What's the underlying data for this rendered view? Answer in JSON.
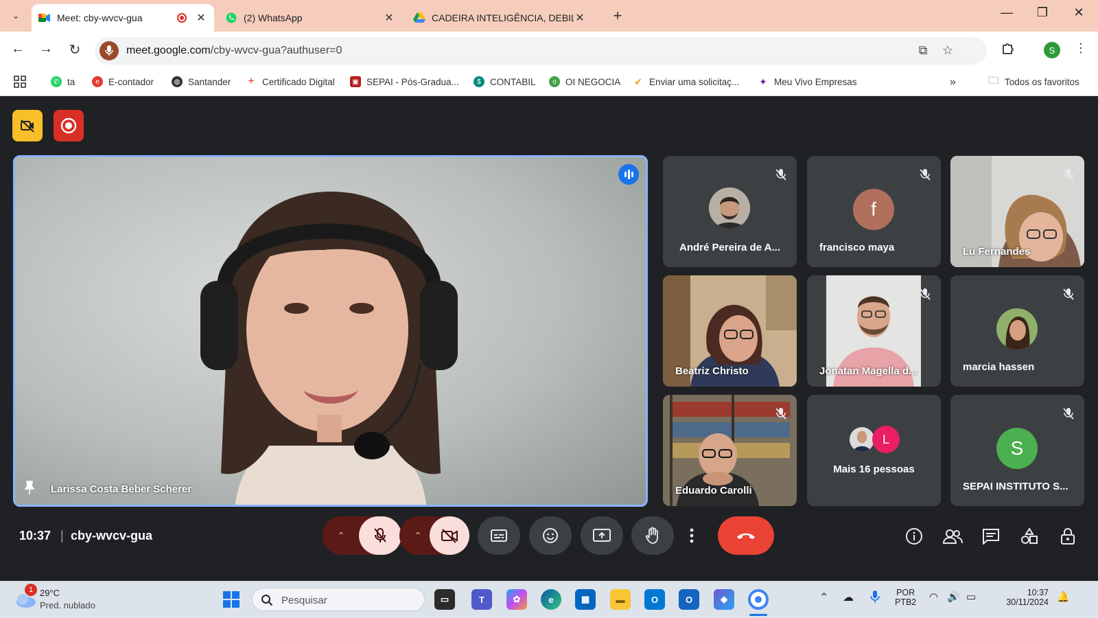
{
  "browser": {
    "tabs": [
      {
        "title": "Meet: cby-wvcv-gua",
        "active": true,
        "recording": true
      },
      {
        "title": "(2) WhatsApp",
        "active": false
      },
      {
        "title": "CADEIRA INTELIGÊNCIA, DEBILI",
        "active": false
      }
    ],
    "url_host": "meet.google.com",
    "url_path": "/cby-wvcv-gua?authuser=0",
    "profile_initial": "S",
    "bookmarks": [
      {
        "label": "ta",
        "icon": "whatsapp-icon",
        "color": "#25d366"
      },
      {
        "label": "E-contador",
        "icon": "e-contador-icon",
        "color": "#e53935"
      },
      {
        "label": "Santander",
        "icon": "globe-icon",
        "color": "#333333"
      },
      {
        "label": "Certificado Digital",
        "icon": "plus-icon",
        "color": "#d93025"
      },
      {
        "label": "SEPAI - Pós-Gradua...",
        "icon": "sepai-icon",
        "color": "#b71c1c"
      },
      {
        "label": "CONTABIL",
        "icon": "contabil-icon",
        "color": "#00897b"
      },
      {
        "label": "OI NEGOCIA",
        "icon": "oi-icon",
        "color": "#43a047"
      },
      {
        "label": "Enviar uma solicitaç...",
        "icon": "vivo-icon",
        "color": "#f39c12"
      },
      {
        "label": "Meu Vivo Empresas",
        "icon": "vivo-person-icon",
        "color": "#7b1fa2"
      }
    ],
    "all_bookmarks": "Todos os favoritos"
  },
  "meeting": {
    "time": "10:37",
    "separator": "|",
    "code": "cby-wvcv-gua",
    "main_speaker": "Larissa Costa Beber Scherer",
    "participants": [
      {
        "name": "André Pereira de A...",
        "muted": true,
        "kind": "photo-avatar"
      },
      {
        "name": "francisco maya",
        "muted": true,
        "kind": "letter",
        "letter": "f",
        "color": "#b0705b"
      },
      {
        "name": "Lu Fernandes",
        "muted": true,
        "kind": "video"
      },
      {
        "name": "Beatriz Christo",
        "muted": false,
        "kind": "video"
      },
      {
        "name": "Jonatan Magella d...",
        "muted": true,
        "kind": "video"
      },
      {
        "name": "marcia hassen",
        "muted": true,
        "kind": "photo-avatar"
      },
      {
        "name": "Eduardo Carolli",
        "muted": true,
        "kind": "video"
      },
      {
        "name": "Mais 16 pessoas",
        "muted": false,
        "kind": "group",
        "letter": "L",
        "color": "#e91e63"
      },
      {
        "name": "SEPAI INSTITUTO S...",
        "muted": true,
        "kind": "letter",
        "letter": "S",
        "color": "#4caf50"
      }
    ]
  },
  "taskbar": {
    "temperature": "29°C",
    "weather": "Pred. nublado",
    "weather_badge": "1",
    "search_placeholder": "Pesquisar",
    "lang_line1": "POR",
    "lang_line2": "PTB2",
    "clock_time": "10:37",
    "clock_date": "30/11/2024"
  }
}
